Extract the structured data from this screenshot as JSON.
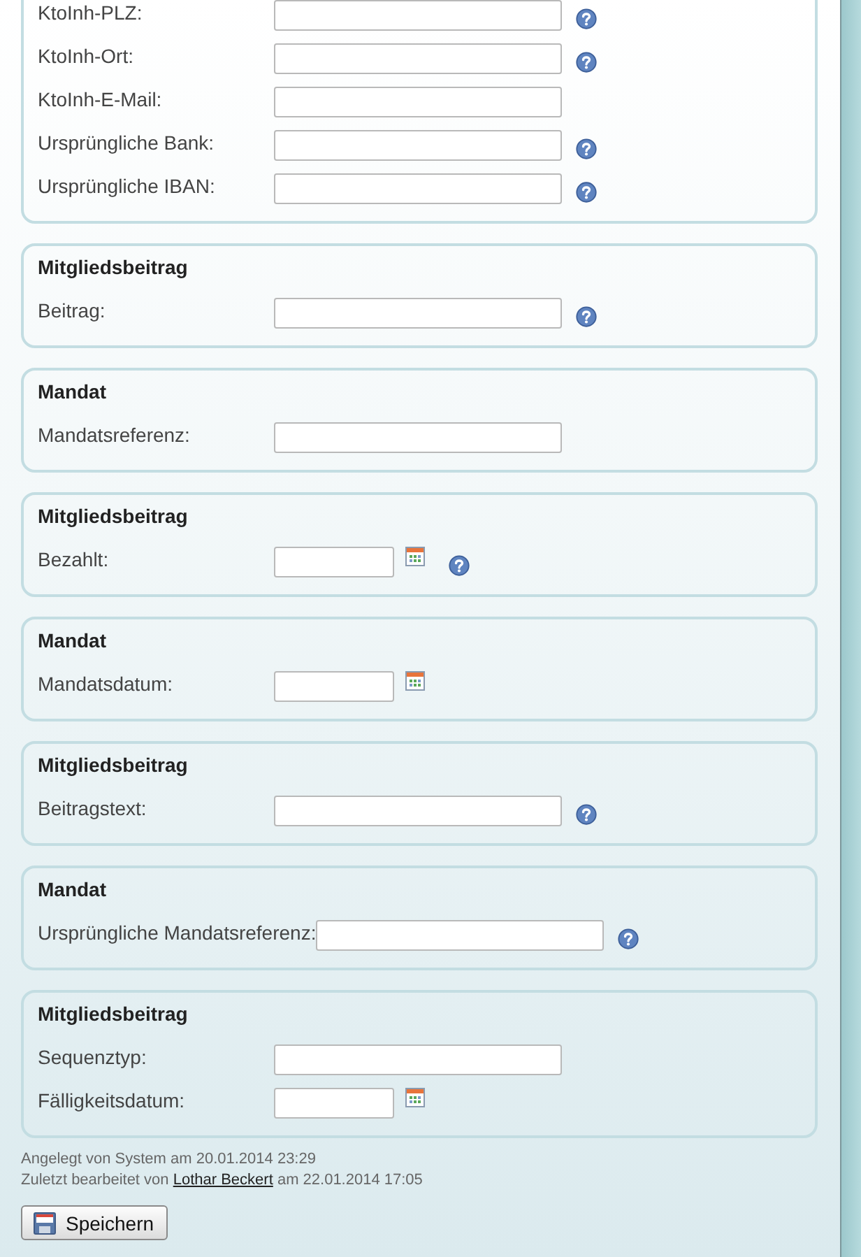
{
  "sections": [
    {
      "fields": [
        {
          "label": "KtoInh-PLZ:",
          "kind": "text",
          "help": true
        },
        {
          "label": "KtoInh-Ort:",
          "kind": "text",
          "help": true
        },
        {
          "label": "KtoInh-E-Mail:",
          "kind": "text",
          "help": false
        },
        {
          "label": "Ursprüngliche Bank:",
          "kind": "text",
          "help": true
        },
        {
          "label": "Ursprüngliche IBAN:",
          "kind": "text",
          "help": true
        }
      ]
    },
    {
      "title": "Mitgliedsbeitrag",
      "fields": [
        {
          "label": "Beitrag:",
          "kind": "text",
          "help": true
        }
      ]
    },
    {
      "title": "Mandat",
      "fields": [
        {
          "label": "Mandatsreferenz:",
          "kind": "text",
          "help": false
        }
      ]
    },
    {
      "title": "Mitgliedsbeitrag",
      "fields": [
        {
          "label": "Bezahlt:",
          "kind": "date",
          "help": true
        }
      ]
    },
    {
      "title": "Mandat",
      "fields": [
        {
          "label": "Mandatsdatum:",
          "kind": "date",
          "help": false
        }
      ]
    },
    {
      "title": "Mitgliedsbeitrag",
      "fields": [
        {
          "label": "Beitragstext:",
          "kind": "text",
          "help": true
        }
      ]
    },
    {
      "title": "Mandat",
      "fields": [
        {
          "label": "Ursprüngliche Mandatsreferenz:",
          "kind": "text",
          "help": true
        }
      ]
    },
    {
      "title": "Mitgliedsbeitrag",
      "fields": [
        {
          "label": "Sequenztyp:",
          "kind": "text",
          "help": false
        },
        {
          "label": "Fälligkeitsdatum:",
          "kind": "date",
          "help": false
        }
      ]
    }
  ],
  "footer": {
    "created": "Angelegt von System am 20.01.2014 23:29",
    "edited_prefix": "Zuletzt bearbeitet von",
    "editor": "Lothar Beckert",
    "edited_suffix": "am 22.01.2014 17:05"
  },
  "save_button": "Speichern"
}
